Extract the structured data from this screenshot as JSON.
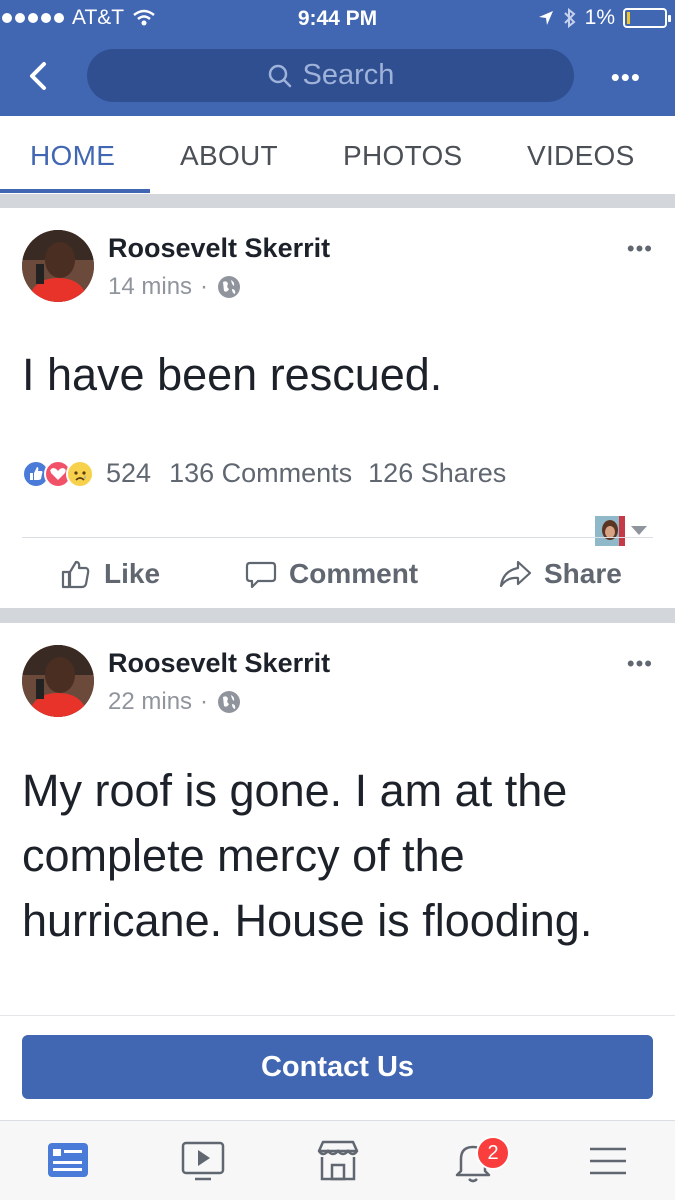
{
  "status_bar": {
    "carrier": "AT&T",
    "time": "9:44 PM",
    "battery": "1%"
  },
  "nav": {
    "search_placeholder": "Search"
  },
  "tabs": [
    {
      "label": "HOME",
      "active": true
    },
    {
      "label": "ABOUT"
    },
    {
      "label": "PHOTOS"
    },
    {
      "label": "VIDEOS"
    }
  ],
  "posts": [
    {
      "author": "Roosevelt Skerrit",
      "time": "14 mins",
      "text": "I have been rescued.",
      "reactions_count": "524",
      "comments": "136 Comments",
      "shares": "126 Shares"
    },
    {
      "author": "Roosevelt Skerrit",
      "time": "22 mins",
      "text": "My roof is gone. I am at the complete mercy of the hurricane. House is flooding."
    }
  ],
  "actions": {
    "like": "Like",
    "comment": "Comment",
    "share": "Share"
  },
  "contact": {
    "label": "Contact Us"
  },
  "bottom_nav": {
    "notifications_badge": "2"
  },
  "colors": {
    "brand": "#4267b2",
    "badge": "#fa3e3e"
  }
}
